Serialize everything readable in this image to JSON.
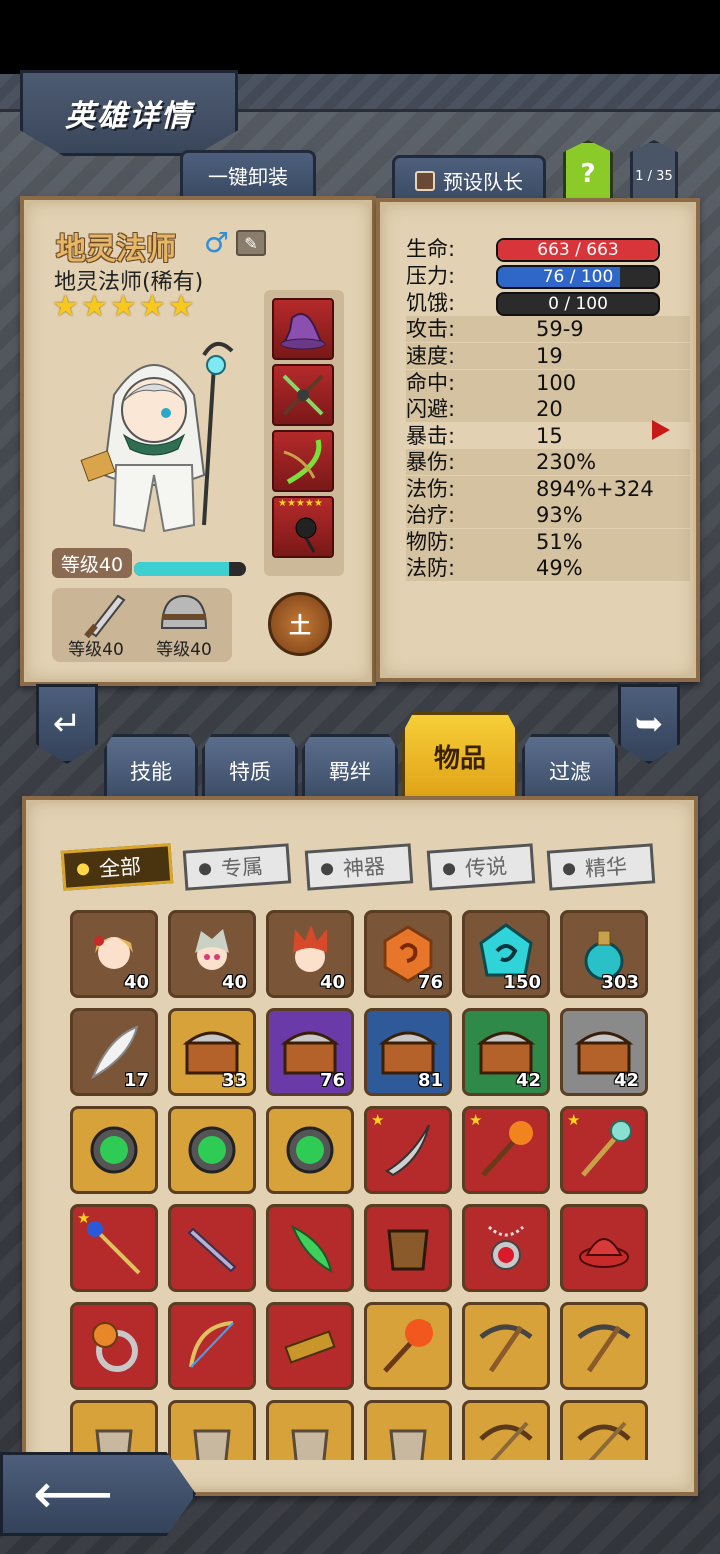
{
  "header": {
    "title": "英雄详情"
  },
  "buttons": {
    "unequip": "一键卸装",
    "preset_captain": "预设队长",
    "help": "?",
    "page": "1 / 35"
  },
  "hero": {
    "name": "地灵法师",
    "gender": "♂",
    "subtitle": "地灵法师(稀有)",
    "stars": 5,
    "level_label": "等级40",
    "exp_progress": 0.85,
    "weapon_level": "等级40",
    "armor_level": "等级40",
    "element": "土"
  },
  "stats": {
    "hp": {
      "label": "生命:",
      "value": "663 / 663",
      "fill": 1.0,
      "color": "#d8353a"
    },
    "stress": {
      "label": "压力:",
      "value": "76 / 100",
      "fill": 0.76,
      "color": "#2f67c9"
    },
    "hunger": {
      "label": "饥饿:",
      "value": "0 / 100",
      "fill": 0.0,
      "color": "#777777"
    },
    "rows": [
      {
        "label": "攻击:",
        "value": "59-9"
      },
      {
        "label": "速度:",
        "value": "19"
      },
      {
        "label": "命中:",
        "value": "100"
      },
      {
        "label": "闪避:",
        "value": "20"
      },
      {
        "label": "暴击:",
        "value": "15"
      },
      {
        "label": "暴伤:",
        "value": "230%"
      },
      {
        "label": "法伤:",
        "value": "894%+324"
      },
      {
        "label": "治疗:",
        "value": "93%"
      },
      {
        "label": "物防:",
        "value": "51%"
      },
      {
        "label": "法防:",
        "value": "49%"
      }
    ]
  },
  "tabs": {
    "skills": "技能",
    "traits": "特质",
    "bonds": "羁绊",
    "items": "物品",
    "filter": "过滤"
  },
  "filters": {
    "all": "全部",
    "exclusive": "专属",
    "artifact": "神器",
    "legend": "传说",
    "essence": "精华"
  },
  "inventory": {
    "row1": [
      "40",
      "40",
      "40",
      "76",
      "150",
      "303"
    ],
    "row2": [
      "17",
      "33",
      "76",
      "81",
      "42",
      "42"
    ]
  },
  "colors": {
    "parchment": "#e2d2b3",
    "gold_tab": "#f7cf38",
    "rarity_red": "#b52a2a",
    "rarity_gold": "#d8a23a",
    "rarity_purple": "#6a3aa8",
    "rarity_blue": "#2f5a9a",
    "rarity_green": "#2f8a4a",
    "rarity_grey": "#8a8a8a",
    "rarity_brown": "#7a5538"
  }
}
